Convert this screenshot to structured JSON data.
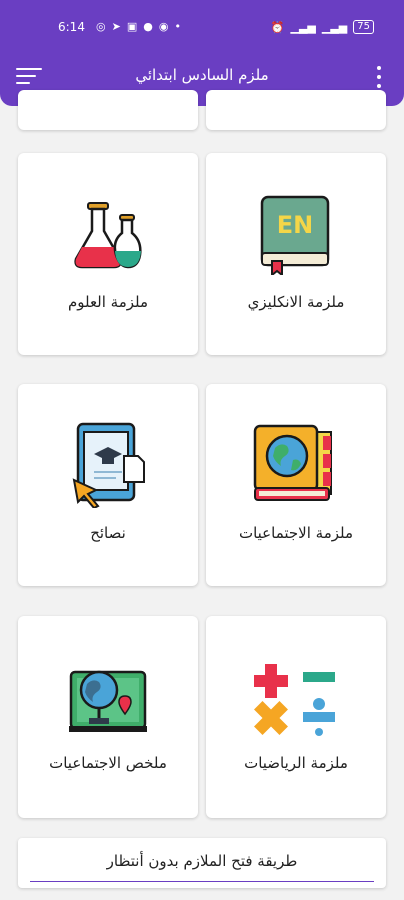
{
  "status_bar": {
    "time": "6:14",
    "app_icons": [
      "whatsapp-icon",
      "telegram-icon",
      "instagram-icon",
      "facebook-icon",
      "reddit-icon",
      "dot-icon"
    ],
    "battery": "75"
  },
  "app_bar": {
    "title": "ملزم السادس ابتدائي",
    "color": "#6a3ec2"
  },
  "cards": {
    "english": {
      "label": "ملزمة الانكليزي",
      "icon": "english-book-icon"
    },
    "science": {
      "label": "ملزمة العلوم",
      "icon": "science-flasks-icon"
    },
    "social": {
      "label": "ملزمة الاجتماعيات",
      "icon": "globe-book-icon"
    },
    "tips": {
      "label": "نصائح",
      "icon": "tablet-graduation-icon"
    },
    "math": {
      "label": "ملزمة الرياضيات",
      "icon": "math-symbols-icon"
    },
    "social_summary": {
      "label": "ملخص الاجتماعيات",
      "icon": "globe-board-icon"
    }
  },
  "bottom_banner": {
    "text": "طريقة فتح الملازم بدون أنتظار"
  }
}
